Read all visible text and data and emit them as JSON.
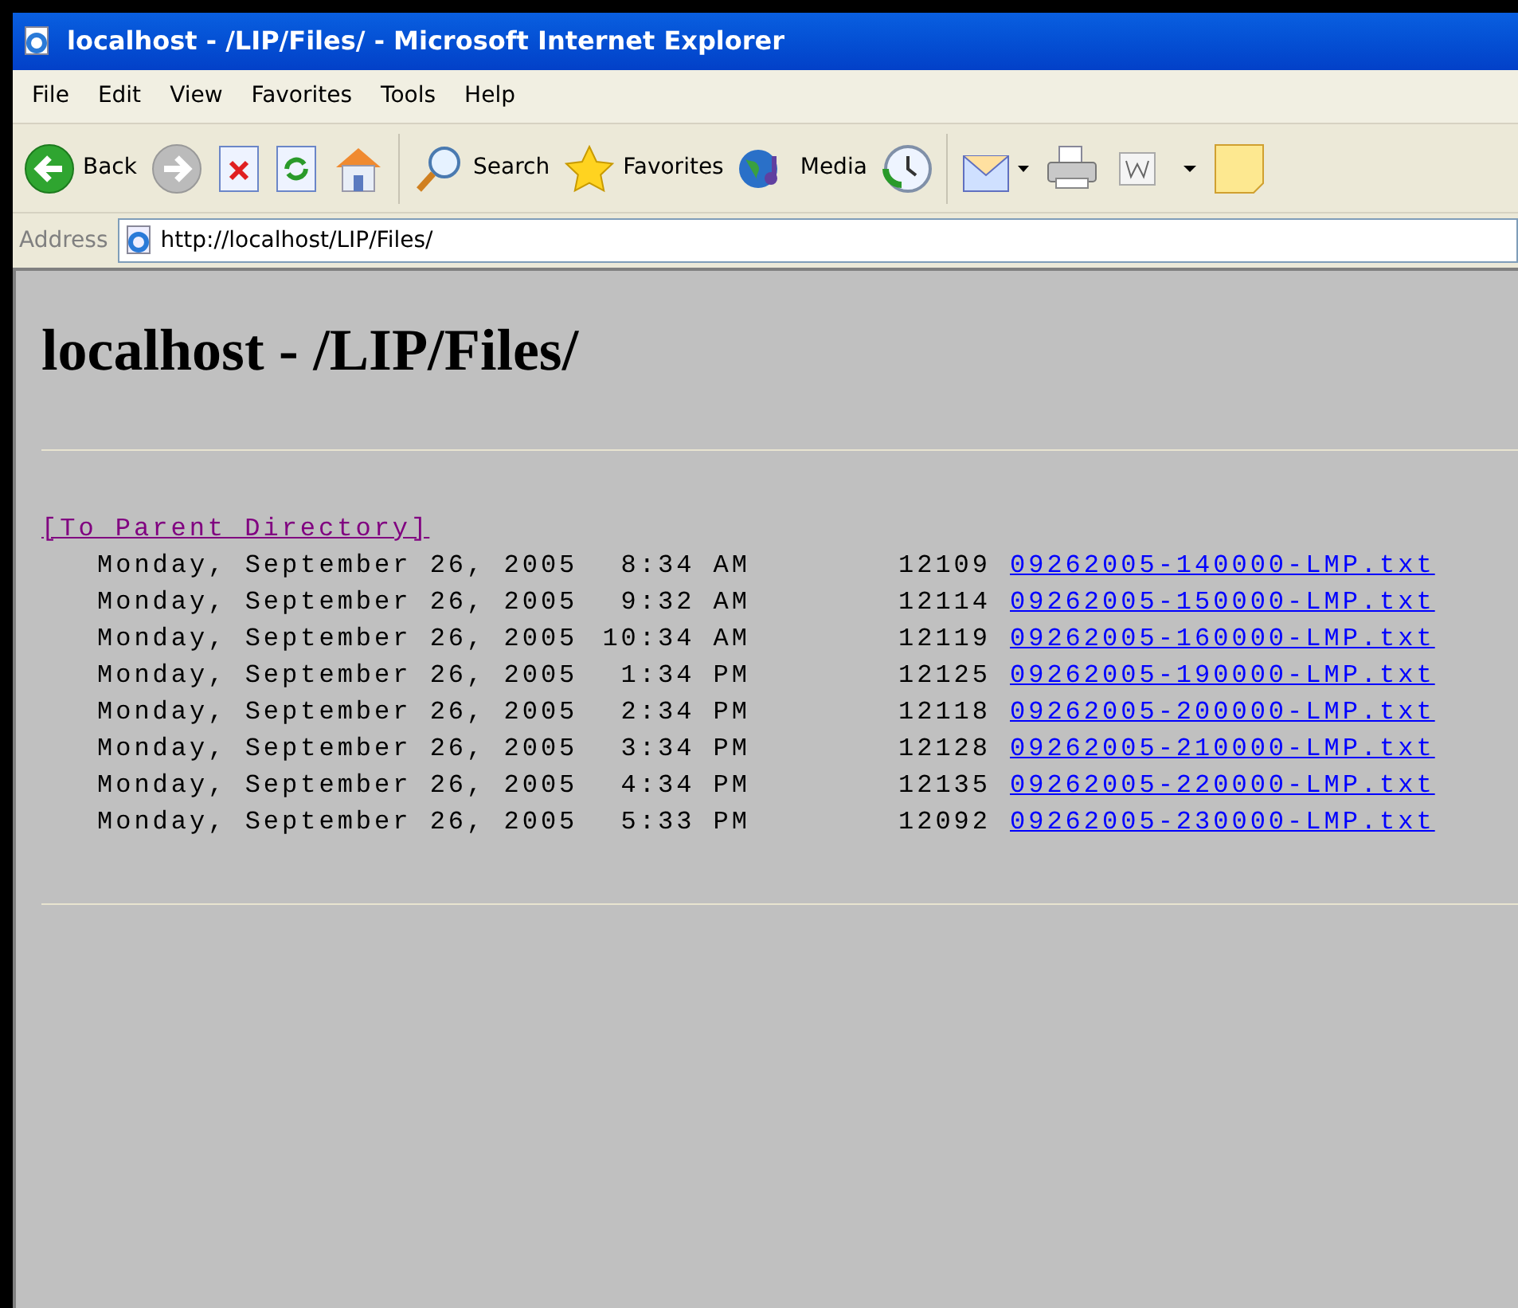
{
  "window": {
    "title": "localhost - /LIP/Files/ - Microsoft Internet Explorer"
  },
  "menu": [
    "File",
    "Edit",
    "View",
    "Favorites",
    "Tools",
    "Help"
  ],
  "toolbar": [
    {
      "kind": "back",
      "label": "Back"
    },
    {
      "kind": "forward"
    },
    {
      "kind": "stop"
    },
    {
      "kind": "refresh"
    },
    {
      "kind": "home"
    },
    {
      "kind": "separator"
    },
    {
      "kind": "search",
      "label": "Search"
    },
    {
      "kind": "favorites",
      "label": "Favorites"
    },
    {
      "kind": "media",
      "label": "Media"
    },
    {
      "kind": "history"
    },
    {
      "kind": "separator"
    },
    {
      "kind": "mail"
    },
    {
      "kind": "print"
    },
    {
      "kind": "word"
    },
    {
      "kind": "note"
    }
  ],
  "address": {
    "label": "Address",
    "value": "http://localhost/LIP/Files/"
  },
  "page": {
    "heading": "localhost - /LIP/Files/",
    "parent_link": "[To Parent Directory]",
    "files": [
      {
        "date": "Monday, September 26, 2005",
        "time": "8:34 AM",
        "size": "12109",
        "name": "09262005-140000-LMP.txt"
      },
      {
        "date": "Monday, September 26, 2005",
        "time": "9:32 AM",
        "size": "12114",
        "name": "09262005-150000-LMP.txt"
      },
      {
        "date": "Monday, September 26, 2005",
        "time": "10:34 AM",
        "size": "12119",
        "name": "09262005-160000-LMP.txt"
      },
      {
        "date": "Monday, September 26, 2005",
        "time": "1:34 PM",
        "size": "12125",
        "name": "09262005-190000-LMP.txt"
      },
      {
        "date": "Monday, September 26, 2005",
        "time": "2:34 PM",
        "size": "12118",
        "name": "09262005-200000-LMP.txt"
      },
      {
        "date": "Monday, September 26, 2005",
        "time": "3:34 PM",
        "size": "12128",
        "name": "09262005-210000-LMP.txt"
      },
      {
        "date": "Monday, September 26, 2005",
        "time": "4:34 PM",
        "size": "12135",
        "name": "09262005-220000-LMP.txt"
      },
      {
        "date": "Monday, September 26, 2005",
        "time": "5:33 PM",
        "size": "12092",
        "name": "09262005-230000-LMP.txt"
      }
    ]
  }
}
